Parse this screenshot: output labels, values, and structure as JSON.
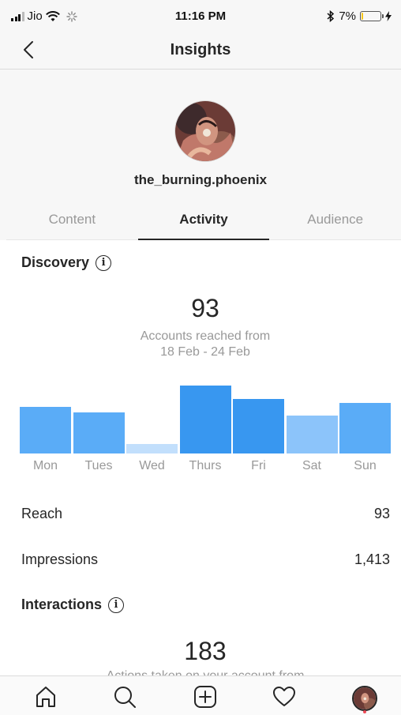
{
  "status_bar": {
    "carrier": "Jio",
    "time": "11:16 PM",
    "battery_percent": "7%",
    "battery_level": 0.07,
    "battery_color": "#f5c518"
  },
  "nav": {
    "title": "Insights",
    "back_icon": "chevron-left-icon"
  },
  "profile": {
    "username": "the_burning.phoenix"
  },
  "tabs": [
    {
      "label": "Content",
      "active": false
    },
    {
      "label": "Activity",
      "active": true
    },
    {
      "label": "Audience",
      "active": false
    }
  ],
  "discovery": {
    "heading": "Discovery",
    "value": "93",
    "subtitle_line1": "Accounts reached from",
    "subtitle_line2": "18 Feb - 24 Feb"
  },
  "chart_data": {
    "type": "bar",
    "categories": [
      "Mon",
      "Tues",
      "Wed",
      "Thurs",
      "Fri",
      "Sat",
      "Sun"
    ],
    "values": [
      0.69,
      0.6,
      0.14,
      1.0,
      0.8,
      0.56,
      0.74
    ],
    "bar_colors": [
      "#5aacf7",
      "#5aacf7",
      "#c2dffc",
      "#3897f0",
      "#3897f0",
      "#8cc4fa",
      "#5aacf7"
    ]
  },
  "stats": [
    {
      "label": "Reach",
      "value": "93"
    },
    {
      "label": "Impressions",
      "value": "1,413"
    }
  ],
  "interactions": {
    "heading": "Interactions",
    "value": "183",
    "subtitle_partial": "Actions taken on your account from"
  },
  "tab_bar": {
    "items": [
      "home-icon",
      "search-icon",
      "new-post-icon",
      "activity-heart-icon",
      "profile-avatar"
    ],
    "notification_color": "#ed4956"
  }
}
